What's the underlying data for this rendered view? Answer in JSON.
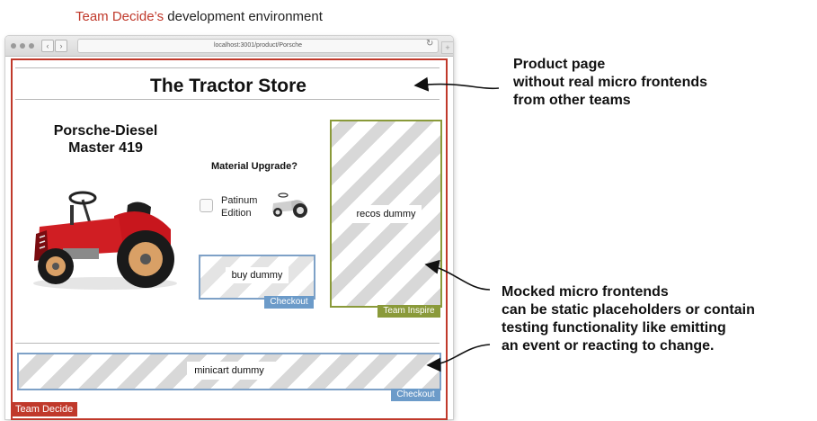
{
  "caption": {
    "highlight": "Team Decide’s",
    "rest": " development environment"
  },
  "browser": {
    "url": "localhost:3001/product/Porsche",
    "back_glyph": "‹",
    "forward_glyph": "›",
    "reload_glyph": "↻",
    "new_tab_glyph": "+"
  },
  "page": {
    "title": "The Tractor Store",
    "product_name_line1": "Porsche-Diesel",
    "product_name_line2": "Master 419",
    "upgrade_heading": "Material Upgrade?",
    "platinum_line1": "Patinum",
    "platinum_line2": "Edition",
    "buy_dummy": "buy dummy",
    "checkout_label": "Checkout",
    "recos_dummy": "recos dummy",
    "inspire_label": "Team Inspire",
    "minicart_dummy": "minicart dummy",
    "checkout_label_2": "Checkout",
    "decide_label": "Team Decide"
  },
  "annotations": {
    "product_page": [
      "Product page",
      "without real micro frontends",
      "from other teams"
    ],
    "mocked": [
      "Mocked micro frontends",
      "can be static placeholders or contain",
      "testing functionality like emitting",
      "an event or reacting to change."
    ]
  },
  "colors": {
    "team_decide": "#c0392b",
    "team_checkout": "#6c9bc9",
    "team_inspire": "#8a9a3a"
  }
}
